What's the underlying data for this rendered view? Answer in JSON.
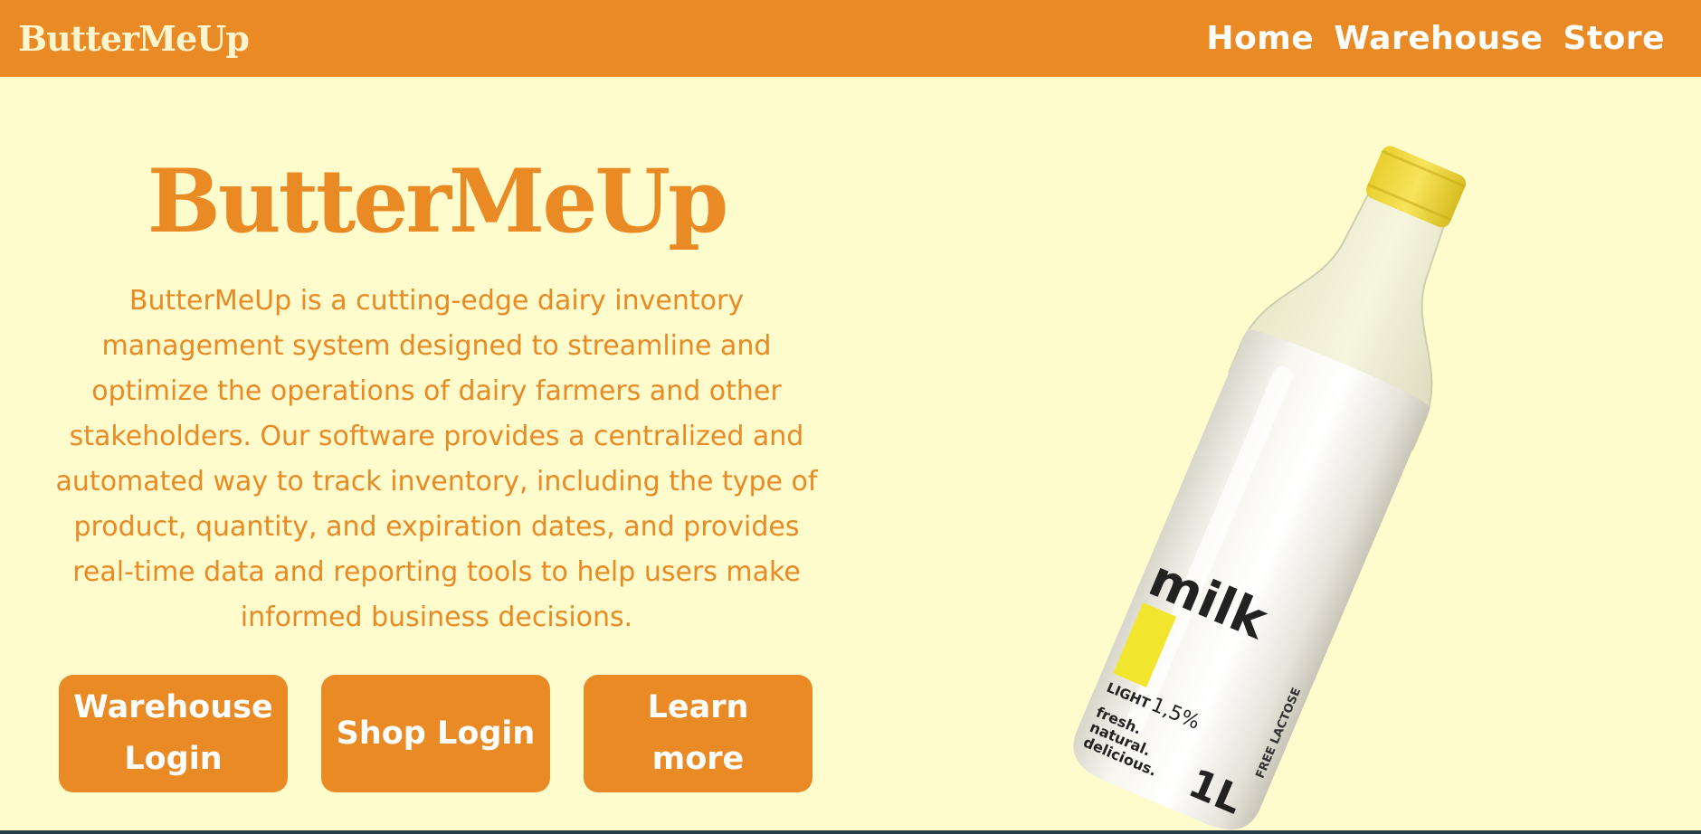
{
  "header": {
    "brand": "ButterMeUp",
    "nav": [
      {
        "label": "Home"
      },
      {
        "label": "Warehouse"
      },
      {
        "label": "Store"
      }
    ]
  },
  "hero": {
    "title": "ButterMeUp",
    "description": "ButterMeUp is a cutting-edge dairy inventory management system designed to streamline and optimize the operations of dairy farmers and other stakeholders. Our software provides a centralized and automated way to track inventory, including the type of product, quantity, and expiration dates, and provides real-time data and reporting tools to help users make informed business decisions."
  },
  "buttons": {
    "warehouse_login": "Warehouse Login",
    "shop_login": "Shop Login",
    "learn_more": "Learn more"
  },
  "product_image": {
    "icon": "milk-bottle-image",
    "label_word": "milk",
    "light": "LIGHT",
    "fat": "1,5%",
    "tagline_1": "fresh.",
    "tagline_2": "natural.",
    "tagline_3": "delicious.",
    "volume": "1L",
    "side_text": "FREE LACTOSE"
  },
  "colors": {
    "accent": "#ea8a25",
    "background": "#fefbcc",
    "cap": "#f2dc3a",
    "footer": "#253d49"
  }
}
